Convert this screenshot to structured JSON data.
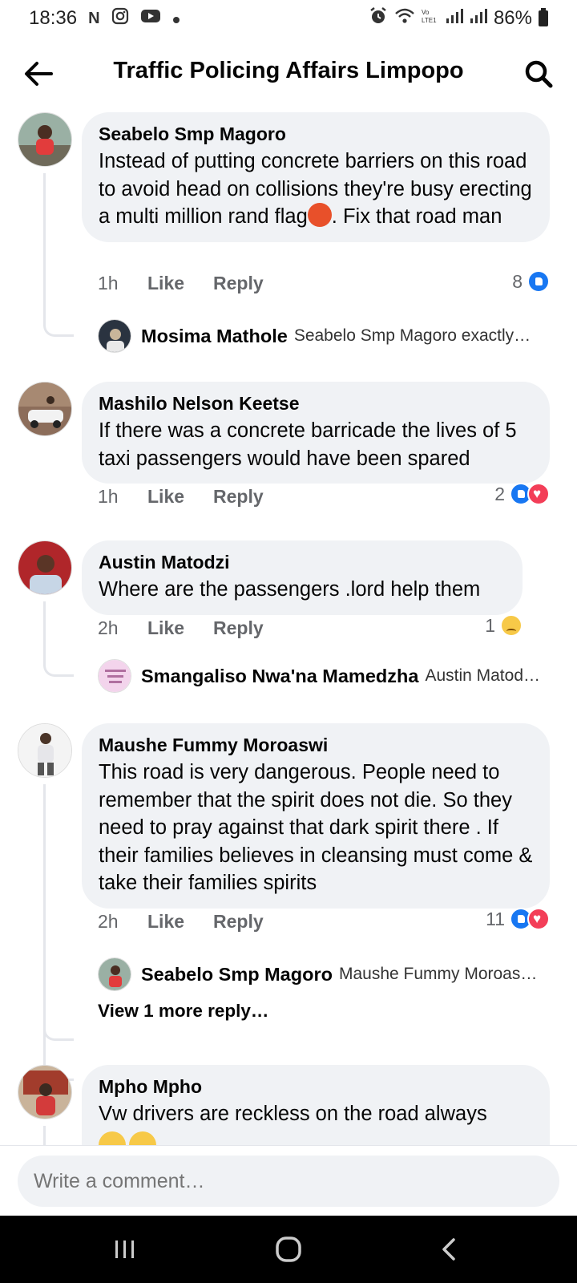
{
  "status_bar": {
    "time": "18:36",
    "battery": "86%",
    "icons": [
      "netflix-icon",
      "instagram-icon",
      "youtube-icon",
      "dot-icon",
      "alarm-icon",
      "wifi-icon",
      "signal-icon",
      "battery-icon"
    ]
  },
  "header": {
    "title": "Traffic Policing Affairs Limpopo",
    "back_icon": "back-arrow-icon",
    "search_icon": "search-icon"
  },
  "comments": [
    {
      "author": "Seabelo Smp Magoro",
      "text_before_emoji": "Instead of putting concrete barriers on this road to avoid head on collisions they're busy erecting a multi million rand flag",
      "emoji": "angry-face-emoji",
      "text_after_emoji": ". Fix that road man",
      "time": "1h",
      "like": "Like",
      "reply": "Reply",
      "reaction_count": "8",
      "reactions": [
        "like"
      ],
      "reply_preview": {
        "author": "Mosima Mathole",
        "text": "Seabelo Smp Magoro exactly…"
      }
    },
    {
      "author": "Mashilo Nelson Keetse",
      "text": "If there was a concrete barricade the lives of 5 taxi passengers would have been spared",
      "time": "1h",
      "like": "Like",
      "reply": "Reply",
      "reaction_count": "2",
      "reactions": [
        "like",
        "love"
      ]
    },
    {
      "author": "Austin Matodzi",
      "text": "Where are the passengers .lord help them",
      "time": "2h",
      "like": "Like",
      "reply": "Reply",
      "reaction_count": "1",
      "reactions": [
        "sad"
      ],
      "reply_preview": {
        "author": "Smangaliso Nwa'na Mamedzha",
        "text": "Austin Matod…"
      }
    },
    {
      "author": "Maushe Fummy Moroaswi",
      "text": "This road is very dangerous. People need to remember that the spirit does not die. So they need to pray against that dark spirit there . If their families believes in cleansing must come & take their families spirits",
      "time": "2h",
      "like": "Like",
      "reply": "Reply",
      "reaction_count": "11",
      "reactions": [
        "like",
        "love"
      ],
      "reply_preview": {
        "author": "Seabelo Smp Magoro",
        "text": "Maushe Fummy Moroas…"
      },
      "view_more": "View 1 more reply…"
    },
    {
      "author": "Mpho Mpho",
      "text": "Vw drivers are reckless on the road always",
      "emojis": [
        "crying-face-emoji",
        "crying-face-emoji"
      ]
    }
  ],
  "composer": {
    "placeholder": "Write a comment…"
  },
  "navbar": {
    "recents_icon": "recents-icon",
    "home_icon": "home-icon",
    "back_icon": "nav-back-icon"
  },
  "colors": {
    "bubble": "#f0f2f5",
    "like_blue": "#1877f2",
    "love_red": "#f33e58",
    "meta_gray": "#65676b"
  }
}
